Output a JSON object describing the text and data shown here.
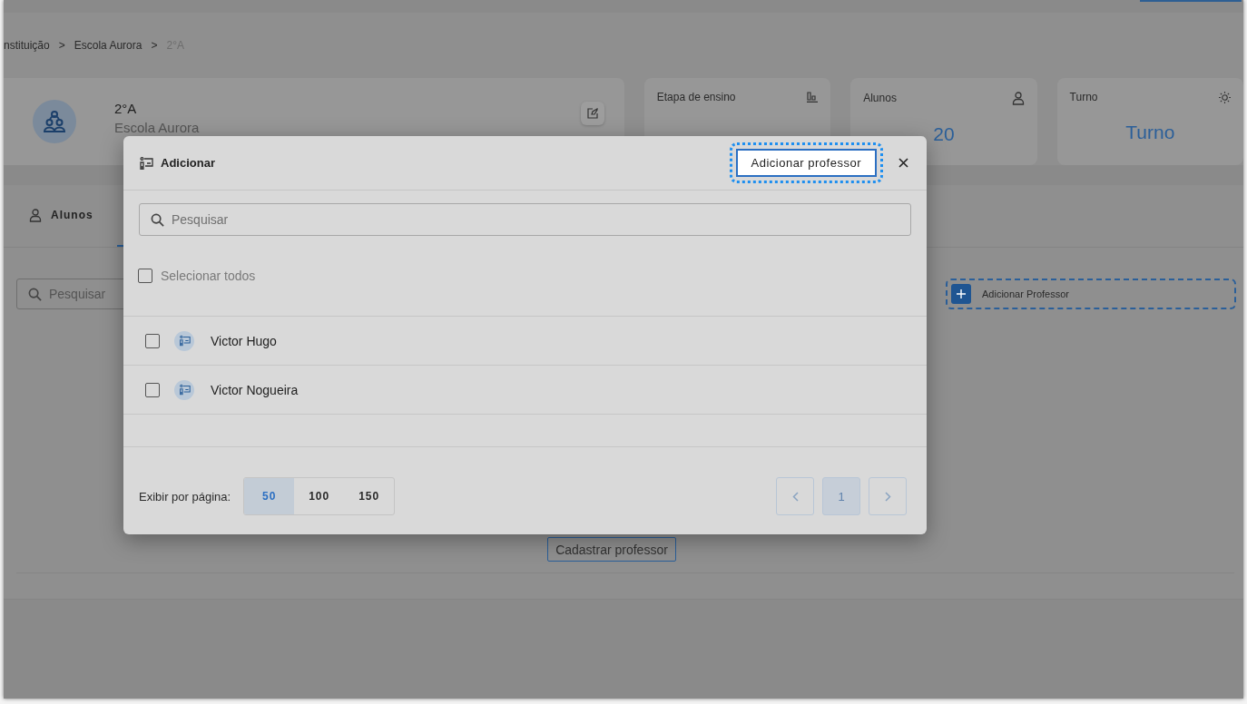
{
  "breadcrumb": {
    "separator": ">",
    "items": [
      {
        "label": "nstituição",
        "current": false
      },
      {
        "label": "Escola Aurora",
        "current": false
      },
      {
        "label": "2°A",
        "current": true
      }
    ]
  },
  "class_card": {
    "title": "2°A",
    "subtitle": "Escola Aurora"
  },
  "stats": [
    {
      "label": "Etapa de ensino",
      "kind": "chart"
    },
    {
      "label": "Alunos",
      "kind": "person",
      "value": "20"
    },
    {
      "label": "Turno",
      "kind": "sun",
      "value": "Turno"
    }
  ],
  "tabs": [
    {
      "label": "Alunos",
      "kind": "person",
      "selected": false
    },
    {
      "kind": "teacher",
      "selected": true
    }
  ],
  "search": {
    "placeholder": "Pesquisar"
  },
  "add_button": {
    "label": "Adicionar Professor"
  },
  "empty_button": {
    "label": "Cadastrar professor"
  },
  "modal": {
    "title": "Adicionar",
    "action": {
      "label": "Adicionar professor",
      "focused": true
    },
    "search": {
      "placeholder": "Pesquisar"
    },
    "select_all": {
      "label": "Selecionar todos",
      "checked": false
    },
    "items": [
      {
        "name": "Victor Hugo",
        "checked": false
      },
      {
        "name": "Victor Nogueira",
        "checked": false
      }
    ],
    "page_size": {
      "label": "Exibir por página:",
      "options": [
        {
          "label": "50",
          "selected": true
        },
        {
          "label": "100",
          "selected": false
        },
        {
          "label": "150",
          "selected": false
        }
      ]
    },
    "pagination": {
      "prev_disabled": true,
      "next_disabled": true,
      "pages": [
        {
          "label": "1",
          "selected": true
        }
      ]
    }
  }
}
